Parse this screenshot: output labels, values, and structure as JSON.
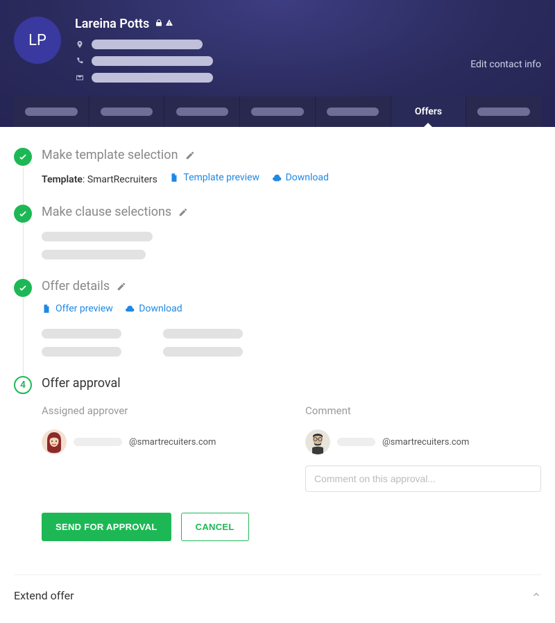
{
  "header": {
    "avatar_initials": "LP",
    "name": "Lareina Potts",
    "edit_contact": "Edit contact info"
  },
  "tabs": {
    "active_index": 5,
    "items": [
      {
        "label": ""
      },
      {
        "label": ""
      },
      {
        "label": ""
      },
      {
        "label": ""
      },
      {
        "label": ""
      },
      {
        "label": "Offers"
      },
      {
        "label": ""
      }
    ]
  },
  "steps": {
    "template": {
      "title": "Make template selection",
      "template_label": "Template",
      "template_value": "SmartRecruiters",
      "preview": "Template preview",
      "download": "Download"
    },
    "clauses": {
      "title": "Make clause selections"
    },
    "details": {
      "title": "Offer details",
      "preview": "Offer preview",
      "download": "Download"
    },
    "approval": {
      "number": "4",
      "title": "Offer approval",
      "assigned_label": "Assigned approver",
      "assigned_email": "@smartrecuiters.com",
      "comment_label": "Comment",
      "comment_email": "@smartrecuiters.com",
      "comment_placeholder": "Comment on this approval..."
    }
  },
  "actions": {
    "send": "SEND FOR APPROVAL",
    "cancel": "CANCEL"
  },
  "extend": {
    "label": "Extend offer"
  }
}
